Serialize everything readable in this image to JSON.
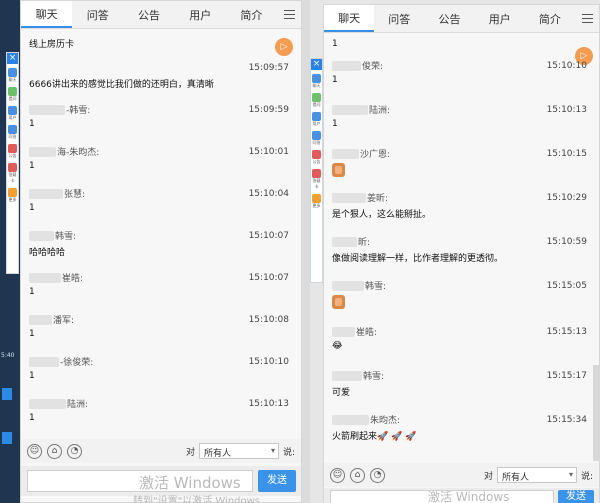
{
  "desktop": {
    "time_text": "5:40"
  },
  "sidebar": {
    "close_icon": "close-icon",
    "items": [
      {
        "label": "聊天",
        "icon": "chat-icon",
        "color": "#4a90e2"
      },
      {
        "label": "提问",
        "icon": "question-icon",
        "color": "#6cc06c"
      },
      {
        "label": "用户",
        "icon": "user-icon",
        "color": "#4a90e2"
      },
      {
        "label": "问答",
        "icon": "qa-icon",
        "color": "#4a90e2"
      },
      {
        "label": "公告",
        "icon": "notice-icon",
        "color": "#e25b5b"
      },
      {
        "label": "答疑卡",
        "icon": "card-icon",
        "color": "#e25b5b"
      },
      {
        "label": "更多",
        "icon": "more-icon",
        "color": "#f0a030"
      }
    ]
  },
  "left_panel": {
    "tabs": [
      "聊天",
      "问答",
      "公告",
      "用户",
      "简介"
    ],
    "active_tab": 0,
    "messages": [
      {
        "name": "",
        "time": "",
        "text": "线上房历卡"
      },
      {
        "name": "",
        "time": "15:09:57",
        "text": "6666讲出来的感觉比我们做的还明白，真清晰"
      },
      {
        "name": "-韩雪:",
        "time": "15:09:59",
        "text": "1"
      },
      {
        "name": "海-朱昀杰:",
        "time": "15:10:01",
        "text": "1"
      },
      {
        "name": "张慧:",
        "time": "15:10:04",
        "text": "1"
      },
      {
        "name": "韩雪:",
        "time": "15:10:07",
        "text": "哈哈哈哈"
      },
      {
        "name": "崔皓:",
        "time": "15:10:07",
        "text": "1"
      },
      {
        "name": "潘军:",
        "time": "15:10:08",
        "text": "1"
      },
      {
        "name": "-徐俊荣:",
        "time": "15:10:10",
        "text": "1"
      },
      {
        "name": "陆洲:",
        "time": "15:10:13",
        "text": "1"
      }
    ],
    "to_label": "对",
    "recipient": "所有人",
    "say_label": "说:",
    "send_label": "发送",
    "watermark": "激活 Windows",
    "watermark_sub": "转到\"设置\"以激活 Windows"
  },
  "right_panel": {
    "tabs": [
      "聊天",
      "问答",
      "公告",
      "用户",
      "简介"
    ],
    "active_tab": 0,
    "messages": [
      {
        "name": "",
        "time": "",
        "text": "1"
      },
      {
        "name": "俊荣:",
        "time": "15:10:10",
        "text": "1"
      },
      {
        "name": "陆洲:",
        "time": "15:10:13",
        "text": "1"
      },
      {
        "name": "沙广恩:",
        "time": "15:10:15",
        "text": "",
        "sticker": "thumbs-up"
      },
      {
        "name": "姜昕:",
        "time": "15:10:29",
        "text": "是个狠人，这么能掰扯。"
      },
      {
        "name": "昕:",
        "time": "15:10:59",
        "text": "像做阅读理解一样，比作者理解的更透彻。"
      },
      {
        "name": "韩雪:",
        "time": "15:15:05",
        "text": "",
        "sticker": "thumbs-up"
      },
      {
        "name": "崔皓:",
        "time": "15:15:13",
        "text": "😂"
      },
      {
        "name": "韩雪:",
        "time": "15:15:17",
        "text": "可爱"
      },
      {
        "name": "朱昀杰:",
        "time": "15:15:34",
        "text": "火箭刷起来🚀 🚀 🚀"
      }
    ],
    "to_label": "对",
    "recipient": "所有人",
    "say_label": "说:",
    "send_label": "发送",
    "watermark": "激活 Windows"
  },
  "colors": {
    "accent": "#3a93e8",
    "panel_bg": "#f7f7f7"
  }
}
